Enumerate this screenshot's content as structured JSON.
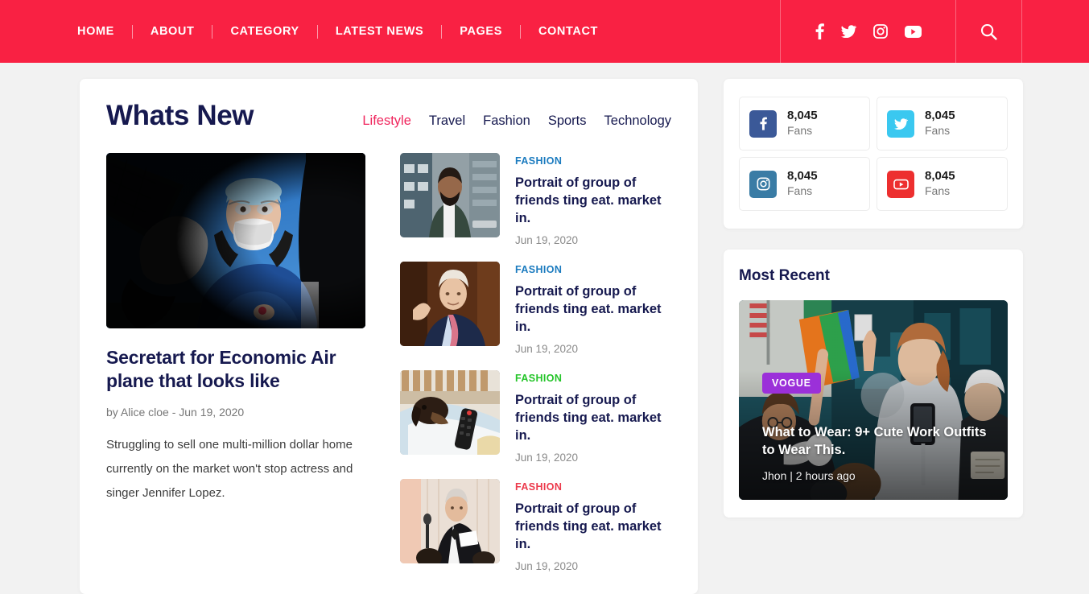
{
  "header": {
    "nav": [
      {
        "label": "HOME",
        "name": "nav-home"
      },
      {
        "label": "ABOUT",
        "name": "nav-about"
      },
      {
        "label": "CATEGORY",
        "name": "nav-category"
      },
      {
        "label": "LATEST NEWS",
        "name": "nav-latest-news"
      },
      {
        "label": "PAGES",
        "name": "nav-pages"
      },
      {
        "label": "CONTACT",
        "name": "nav-contact"
      }
    ],
    "social": [
      "facebook-icon",
      "twitter-icon",
      "instagram-icon",
      "youtube-icon"
    ],
    "search_icon": "search-icon",
    "background": "#f92143"
  },
  "whats_new": {
    "title": "Whats New",
    "tabs": [
      {
        "label": "Lifestyle",
        "active": true
      },
      {
        "label": "Travel",
        "active": false
      },
      {
        "label": "Fashion",
        "active": false
      },
      {
        "label": "Sports",
        "active": false
      },
      {
        "label": "Technology",
        "active": false
      }
    ],
    "active_color": "#f0245c",
    "feature": {
      "title": "Secretart for Economic Air plane that looks like",
      "meta": "by Alice cloe - Jun 19, 2020",
      "excerpt": "Struggling to sell one multi-million dollar home currently on the market won't stop actress and singer Jennifer Lopez.",
      "image_alt": "doctor-in-ppe-photo"
    },
    "list": [
      {
        "category": "FASHION",
        "color": "#1b7bbf",
        "title": "Portrait of group of friends ting eat. market in.",
        "date": "Jun 19, 2020",
        "image_alt": "man-in-green-jacket-photo"
      },
      {
        "category": "FASHION",
        "color": "#1b7bbf",
        "title": "Portrait of group of friends ting eat. market in.",
        "date": "Jun 19, 2020",
        "image_alt": "politician-waving-photo"
      },
      {
        "category": "FASHION",
        "color": "#25c52a",
        "title": "Portrait of group of friends ting eat. market in.",
        "date": "Jun 19, 2020",
        "image_alt": "dog-with-remote-photo"
      },
      {
        "category": "FASHION",
        "color": "#ec3a4c",
        "title": "Portrait of group of friends ting eat. market in.",
        "date": "Jun 19, 2020",
        "image_alt": "man-in-tuxedo-photo"
      }
    ]
  },
  "sidebar": {
    "fans": [
      {
        "network": "facebook-icon",
        "count": "8,045",
        "label": "Fans",
        "color": "#3b5998"
      },
      {
        "network": "twitter-icon",
        "count": "8,045",
        "label": "Fans",
        "color": "#3ac8f0"
      },
      {
        "network": "instagram-icon",
        "count": "8,045",
        "label": "Fans",
        "color": "#3a7ca5"
      },
      {
        "network": "youtube-icon",
        "count": "8,045",
        "label": "Fans",
        "color": "#ed2f2f"
      }
    ],
    "most_recent": {
      "heading": "Most Recent",
      "badge": "VOGUE",
      "badge_color": "#9b30d9",
      "title": "What to Wear: 9+ Cute Work Outfits to Wear This.",
      "meta": "Jhon | 2 hours ago",
      "image_alt": "street-parade-crowd-photo"
    }
  }
}
